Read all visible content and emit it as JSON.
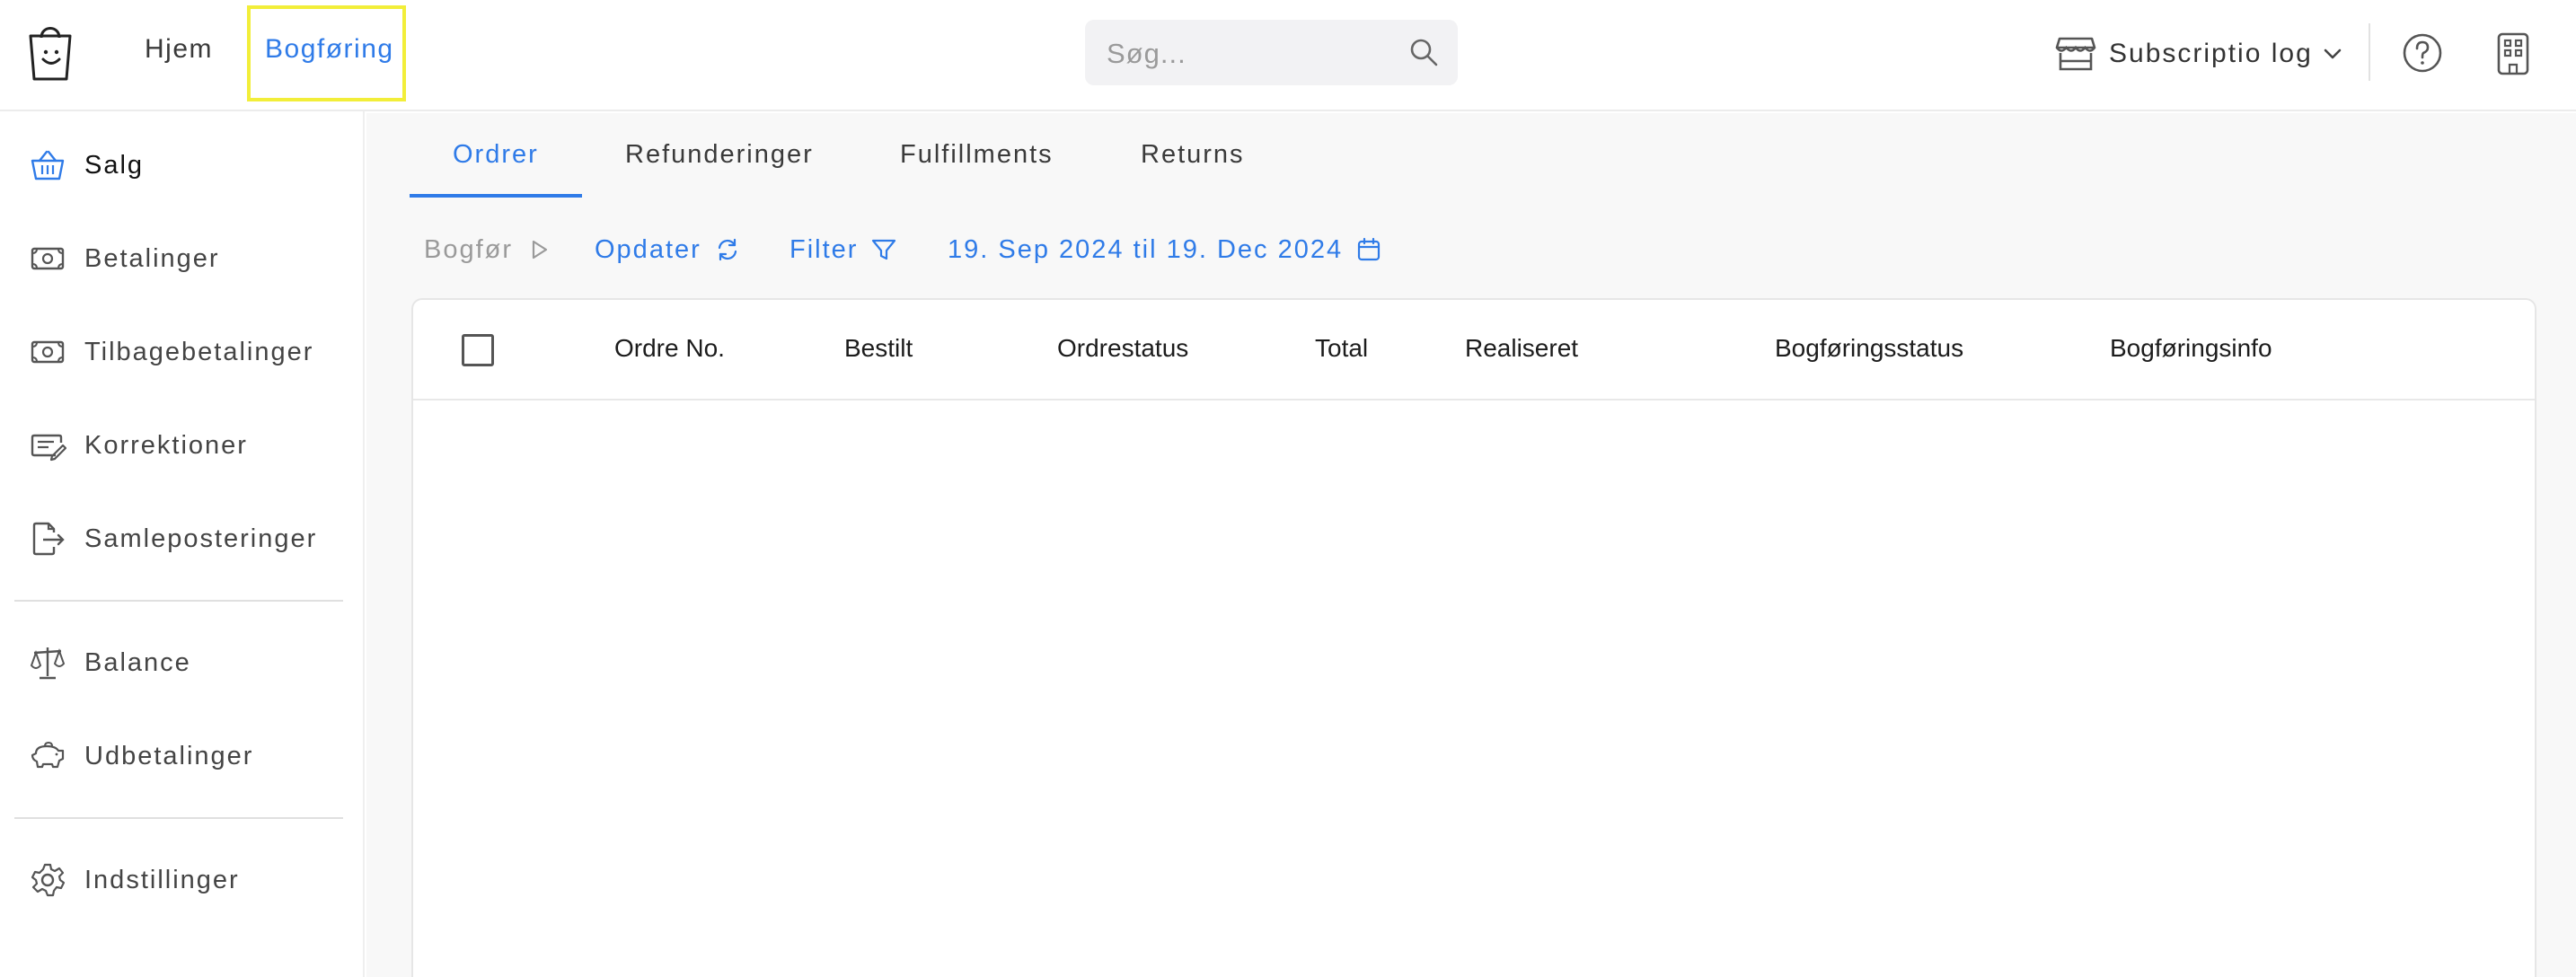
{
  "topbar": {
    "nav": {
      "home": "Hjem",
      "bookkeeping": "Bogføring"
    },
    "search": {
      "placeholder": "Søg..."
    },
    "store": {
      "label": "Subscriptio log"
    },
    "icons": {
      "logo": "shopping-bag-logo",
      "search": "search-icon",
      "store": "store-icon",
      "chevron": "chevron-down-icon",
      "help": "help-icon",
      "building": "building-icon"
    }
  },
  "sidebar": {
    "items": [
      {
        "label": "Salg",
        "icon": "basket-icon"
      },
      {
        "label": "Betalinger",
        "icon": "banknote-icon"
      },
      {
        "label": "Tilbagebetalinger",
        "icon": "banknote-icon"
      },
      {
        "label": "Korrektioner",
        "icon": "edit-card-icon"
      },
      {
        "label": "Samleposteringer",
        "icon": "file-export-icon"
      },
      {
        "label": "Balance",
        "icon": "scale-icon"
      },
      {
        "label": "Udbetalinger",
        "icon": "piggy-bank-icon"
      },
      {
        "label": "Indstillinger",
        "icon": "gear-icon"
      }
    ]
  },
  "main": {
    "tabs": [
      {
        "label": "Ordrer"
      },
      {
        "label": "Refunderinger"
      },
      {
        "label": "Fulfillments"
      },
      {
        "label": "Returns"
      }
    ],
    "toolbar": {
      "book": "Bogfør",
      "update": "Opdater",
      "filter": "Filter",
      "date_range": "19. Sep 2024 til 19. Dec 2024"
    },
    "table": {
      "columns": [
        "Ordre No.",
        "Bestilt",
        "Ordrestatus",
        "Total",
        "Realiseret",
        "Bogføringsstatus",
        "Bogføringsinfo"
      ],
      "rows": []
    }
  },
  "colors": {
    "accent": "#2f7be8",
    "highlight": "#f2ee39"
  }
}
